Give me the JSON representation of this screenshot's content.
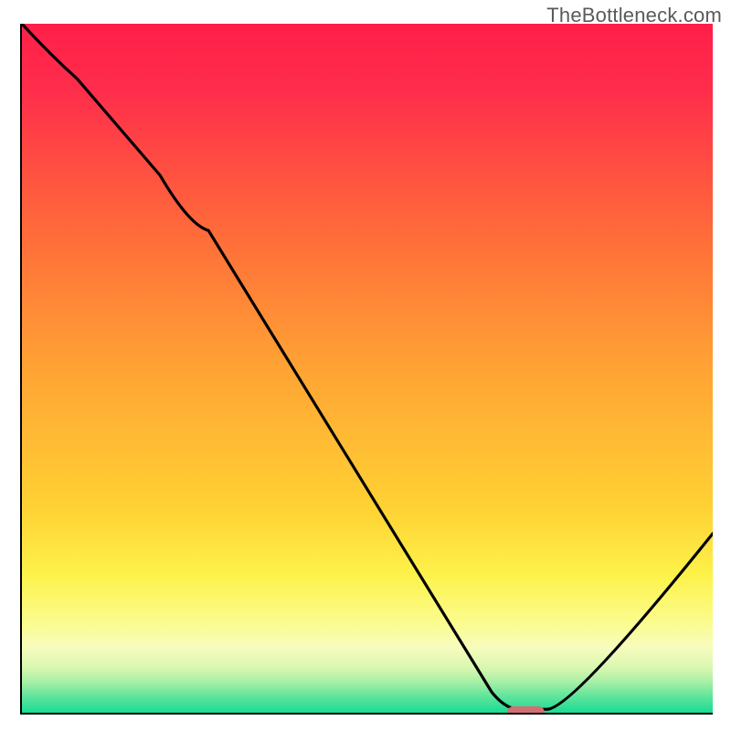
{
  "watermark": "TheBottleneck.com",
  "marker": {
    "left_pct": 70.2,
    "width_pct": 5.5
  },
  "gradient_stops": [
    {
      "offset": 0,
      "color": "#ff1f4a"
    },
    {
      "offset": 0.1,
      "color": "#ff2e4b"
    },
    {
      "offset": 0.3,
      "color": "#ff6a3a"
    },
    {
      "offset": 0.5,
      "color": "#ffa334"
    },
    {
      "offset": 0.7,
      "color": "#ffd133"
    },
    {
      "offset": 0.8,
      "color": "#fdf24a"
    },
    {
      "offset": 0.87,
      "color": "#fbfc8f"
    },
    {
      "offset": 0.905,
      "color": "#f7fcbd"
    },
    {
      "offset": 0.935,
      "color": "#d8f7b0"
    },
    {
      "offset": 0.955,
      "color": "#a9efa6"
    },
    {
      "offset": 0.975,
      "color": "#64e59c"
    },
    {
      "offset": 1.0,
      "color": "#19db95"
    }
  ],
  "chart_data": {
    "type": "line",
    "title": "",
    "xlabel": "",
    "ylabel": "",
    "xlim": [
      0,
      100
    ],
    "ylim": [
      0,
      100
    ],
    "grid": false,
    "curve": {
      "x": [
        0,
        8,
        20,
        27,
        68,
        72,
        76,
        100
      ],
      "y_pct": [
        100,
        92,
        78,
        70,
        3,
        0.5,
        0.5,
        26
      ],
      "note": "y expressed as percent of vertical axis (0 = bottom baseline, 100 = top). Curve starts top-left, bends near x≈27, dives to near-zero plateau around x≈70–76 (optimal zone), then rises toward right edge."
    },
    "highlight": {
      "x_start_pct": 70.2,
      "x_end_pct": 75.7,
      "meaning": "optimal / no-bottleneck zone marker on baseline"
    },
    "background_scale": {
      "top_color": "#ff1f4a",
      "bottom_color": "#19db95",
      "meaning": "red (top) = high bottleneck, green (bottom) = no bottleneck"
    }
  }
}
